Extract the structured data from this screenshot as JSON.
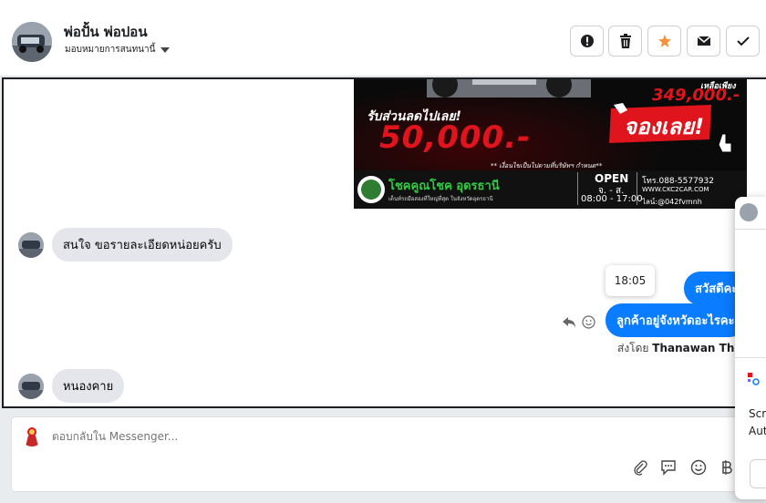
{
  "header": {
    "contact_name": "พ่อปั้น พ่อปอน",
    "assign_label": "มอบหมายการสนทนานี้",
    "actions": [
      {
        "name": "mark-spam-button",
        "icon": "alert-circle-icon"
      },
      {
        "name": "delete-button",
        "icon": "trash-icon"
      },
      {
        "name": "star-button",
        "icon": "star-icon"
      },
      {
        "name": "mark-unread-button",
        "icon": "envelope-icon"
      },
      {
        "name": "mark-done-button",
        "icon": "check-icon"
      }
    ]
  },
  "banner": {
    "discount_heading": "รับส่วนลดไปเลย!",
    "discount_amount": "50,000.-",
    "remaining_label": "เหลือเพียง",
    "remaining_amount": "349,000.-",
    "cta": "จองเลย!",
    "condition_note": "** เงื่อนไขเป็นไปตามที่บริษัทฯ กำหนด**",
    "dealer_name": "โชคคูณโชค อุดรธานี",
    "dealer_tagline": "เต็นท์รถมือสองที่ใหญ่ที่สุด ในจังหวัดอุดรธานี",
    "open_label": "OPEN",
    "open_days": "จ. - ส.",
    "open_hours": "08:00 - 17:00",
    "phone": "โทร.088-5577932",
    "website": "WWW.CKC2CAR.COM",
    "line": "ไลน์:@042fvmnh"
  },
  "messages": {
    "incoming_1": "สนใจ ขอรายละเอียดหน่อยครับ",
    "outgoing_1": "สวัสดีคะ",
    "outgoing_2": "ลูกค้าอยู่จังหวัดอะไรคะ",
    "timestamp_tooltip": "18:05",
    "sent_by_prefix": "ส่งโดย",
    "sent_by_name": "Thanawan Thon",
    "incoming_2": "หนองคาย"
  },
  "composer": {
    "placeholder": "ตอบกลับใน Messenger...",
    "tools": [
      "paperclip-icon",
      "saved-reply-icon",
      "emoji-icon",
      "baht-icon"
    ]
  },
  "float_panel": {
    "snippet_1": "Scr",
    "snippet_2": "Aut"
  },
  "colors": {
    "accent": "#0a7cff",
    "banner_red": "#e0141c",
    "star_orange": "#f7923a"
  }
}
